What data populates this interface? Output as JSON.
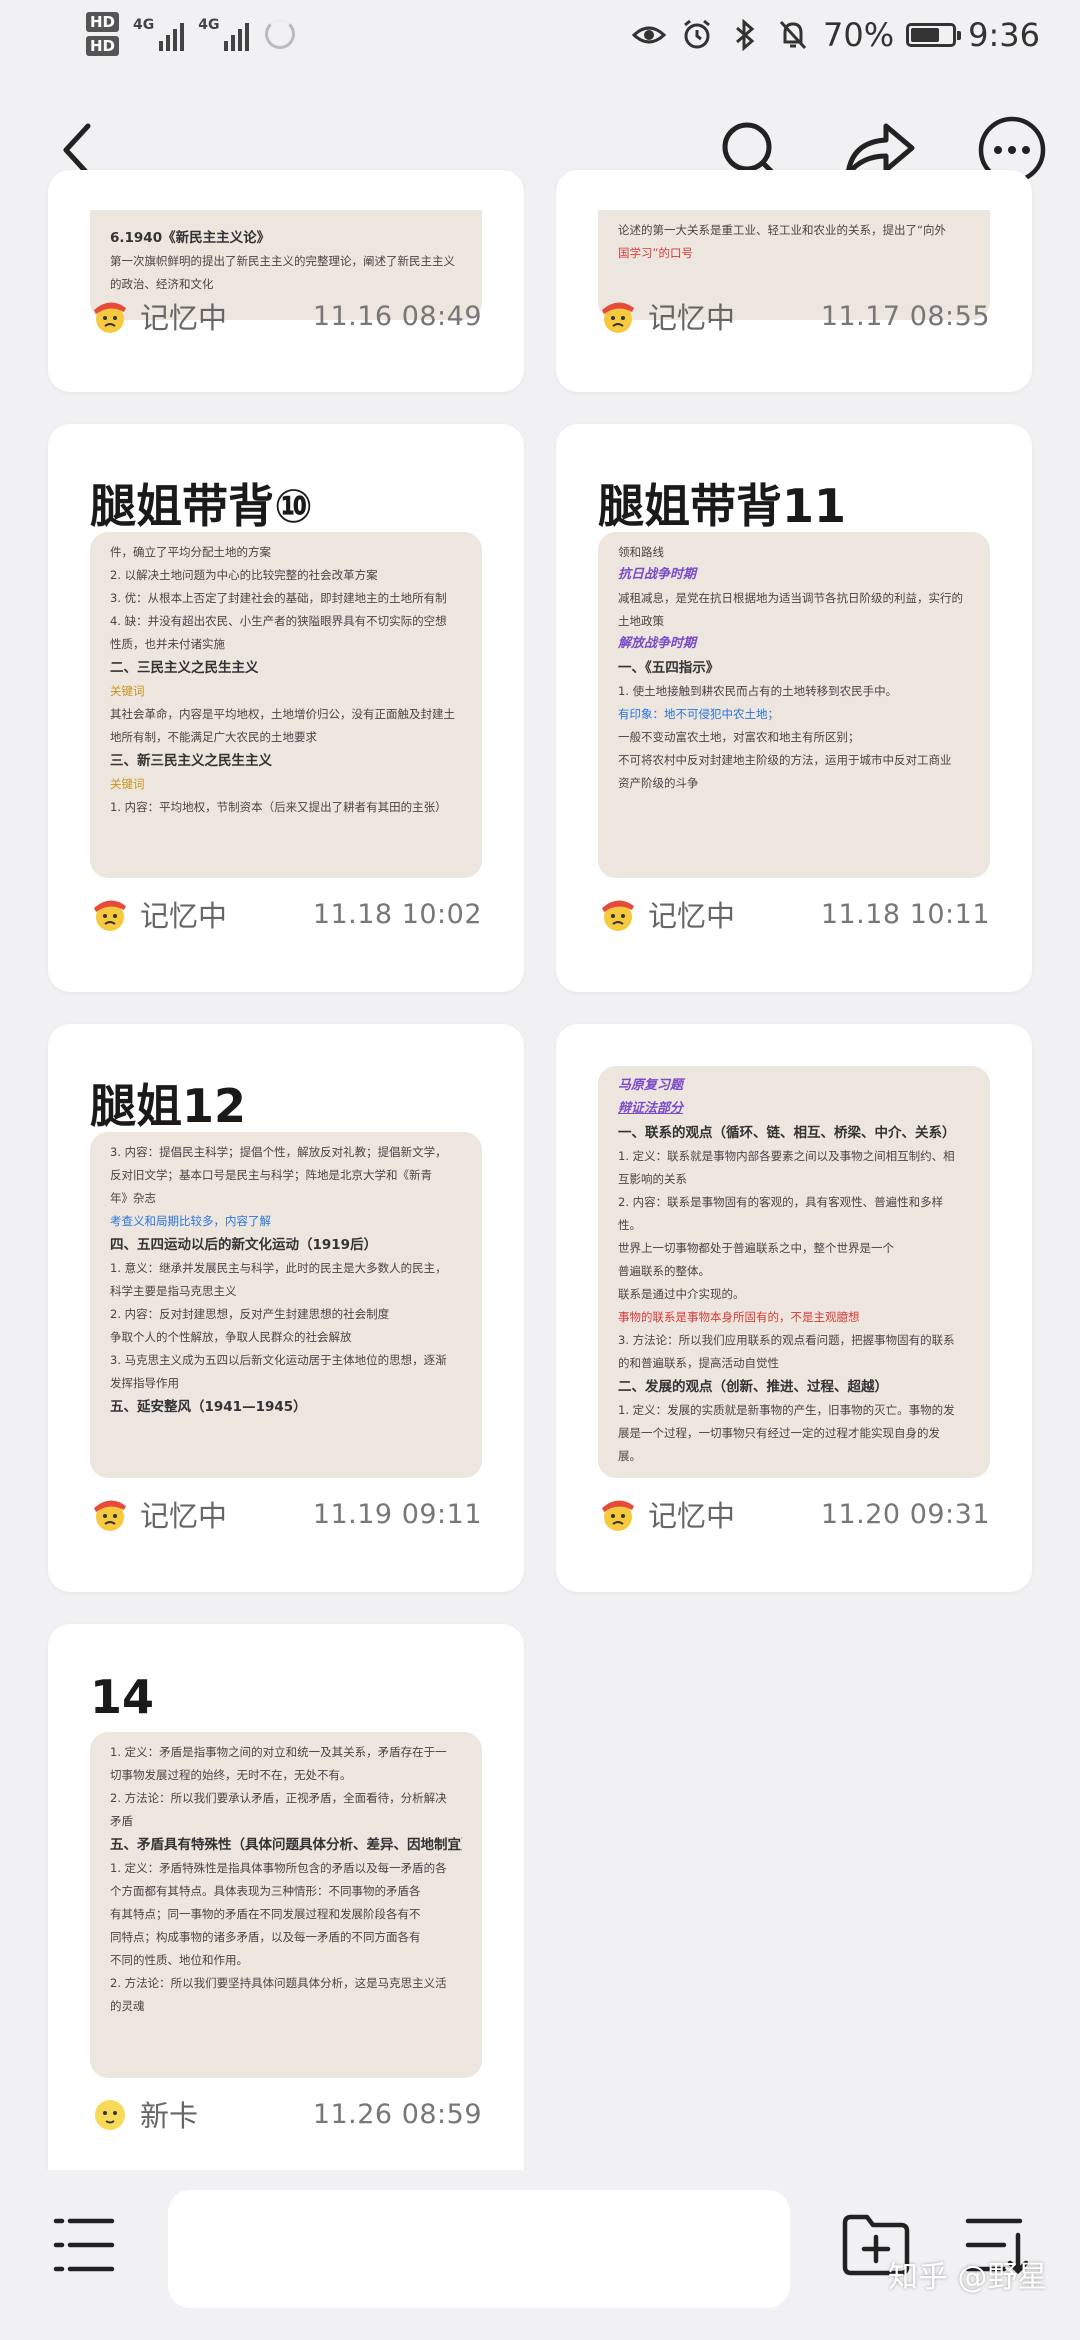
{
  "status_bar": {
    "hd1": "HD",
    "hd2": "HD",
    "net1": "4G",
    "net2": "4G",
    "battery_percent": "70%",
    "battery_level": 0.7,
    "time": "9:36"
  },
  "cards": [
    {
      "title": "",
      "thumb_lines": [
        "6.1940《新民主主义论》",
        "第一次旗帜鲜明的提出了新民主主义的完整理论，阐述了新民主主义",
        "的政治、经济和文化"
      ],
      "status": "记忆中",
      "date": "11.16 08:49"
    },
    {
      "title": "",
      "thumb_lines": [
        "论述的第一大关系是重工业、轻工业和农业的关系，提出了“向外",
        "国学习”的口号"
      ],
      "status": "记忆中",
      "date": "11.17 08:55"
    },
    {
      "title": "腿姐带背⑩",
      "thumb_lines": [
        "件，确立了平均分配土地的方案",
        "2. 以解决土地问题为中心的比较完整的社会改革方案",
        "3. 优：从根本上否定了封建社会的基础，即封建地主的土地所有制",
        "4. 缺：并没有超出农民、小生产者的狭隘眼界具有不切实际的空想",
        "性质，也并未付诸实施",
        "二、三民主义之民生主义",
        "关键词",
        "其社会革命，内容是平均地权，土地增价归公，没有正面触及封建土",
        "地所有制，不能满足广大农民的土地要求",
        "三、新三民主义之民生主义",
        "关键词",
        "1. 内容：平均地权，节制资本（后来又提出了耕者有其田的主张）"
      ],
      "status": "记忆中",
      "date": "11.18 10:02"
    },
    {
      "title": "腿姐带背11",
      "thumb_lines": [
        "领和路线",
        "抗日战争时期",
        "减租减息，是党在抗日根据地为适当调节各抗日阶级的利益，实行的",
        "土地政策",
        "解放战争时期",
        "一、《五四指示》",
        "1. 使土地接触到耕农民而占有的土地转移到农民手中。",
        "有印象：地不可侵犯中农土地；",
        "一般不变动富农土地，对富农和地主有所区别；",
        "不可将农村中反对封建地主阶级的方法，运用于城市中反对工商业",
        "资产阶级的斗争"
      ],
      "status": "记忆中",
      "date": "11.18 10:11"
    },
    {
      "title": "腿姐12",
      "thumb_lines": [
        "3. 内容：提倡民主科学；提倡个性，解放反对礼教；提倡新文学，",
        "反对旧文学；基本口号是民主与科学；阵地是北京大学和《新青",
        "年》杂志",
        "考查义和局期比较多，内容了解",
        "四、五四运动以后的新文化运动（1919后）",
        "1. 意义：继承并发展民主与科学，此时的民主是大多数人的民主，",
        "科学主要是指马克思主义",
        "2. 内容：反对封建思想，反对产生封建思想的社会制度",
        "争取个人的个性解放，争取人民群众的社会解放",
        "3. 马克思主义成为五四以后新文化运动居于主体地位的思想，逐渐",
        "发挥指导作用",
        "五、延安整风（1941—1945）"
      ],
      "status": "记忆中",
      "date": "11.19 09:11"
    },
    {
      "title": "",
      "thumb_lines": [
        "马原复习题",
        "辩证法部分",
        "一、联系的观点（循环、链、相互、桥梁、中介、关系）",
        "1. 定义：联系就是事物内部各要素之间以及事物之间相互制约、相",
        "互影响的关系",
        "2. 内容：联系是事物固有的客观的，具有客观性、普遍性和多样",
        "性。",
        "世界上一切事物都处于普遍联系之中，整个世界是一个",
        "普遍联系的整体。",
        "联系是通过中介实现的。",
        "事物的联系是事物本身所固有的，不是主观臆想",
        "3. 方法论：所以我们应用联系的观点看问题，把握事物固有的联系",
        "的和普遍联系，提高活动自觉性",
        "二、发展的观点（创新、推进、过程、超越）",
        "1. 定义：发展的实质就是新事物的产生，旧事物的灭亡。事物的发",
        "展是一个过程，一切事物只有经过一定的过程才能实现自身的发",
        "展。"
      ],
      "status": "记忆中",
      "date": "11.20 09:31"
    },
    {
      "title": "14",
      "thumb_lines": [
        "1. 定义：矛盾是指事物之间的对立和统一及其关系，矛盾存在于一",
        "切事物发展过程的始终，无时不在，无处不有。",
        "2. 方法论：所以我们要承认矛盾，正视矛盾，全面看待，分析解决",
        "矛盾",
        "五、矛盾具有特殊性（具体问题具体分析、差异、因地制宜）",
        "1. 定义：矛盾特殊性是指具体事物所包含的矛盾以及每一矛盾的各",
        "个方面都有其特点。具体表现为三种情形：不同事物的矛盾各",
        "有其特点；同一事物的矛盾在不同发展过程和发展阶段各有不",
        "同特点；构成事物的诸多矛盾，以及每一矛盾的不同方面各有",
        "不同的性质、地位和作用。",
        "2. 方法论：所以我们要坚持具体问题具体分析，这是马克思主义活",
        "的灵魂"
      ],
      "status": "新卡",
      "date": "11.26 08:59"
    }
  ],
  "icons": {
    "back": "back-arrow-icon",
    "search": "search-icon",
    "share": "share-icon",
    "more": "more-icon",
    "menu": "list-menu-icon",
    "new_folder": "add-folder-icon",
    "sort": "sort-icon"
  },
  "watermark": "知乎 @野星"
}
